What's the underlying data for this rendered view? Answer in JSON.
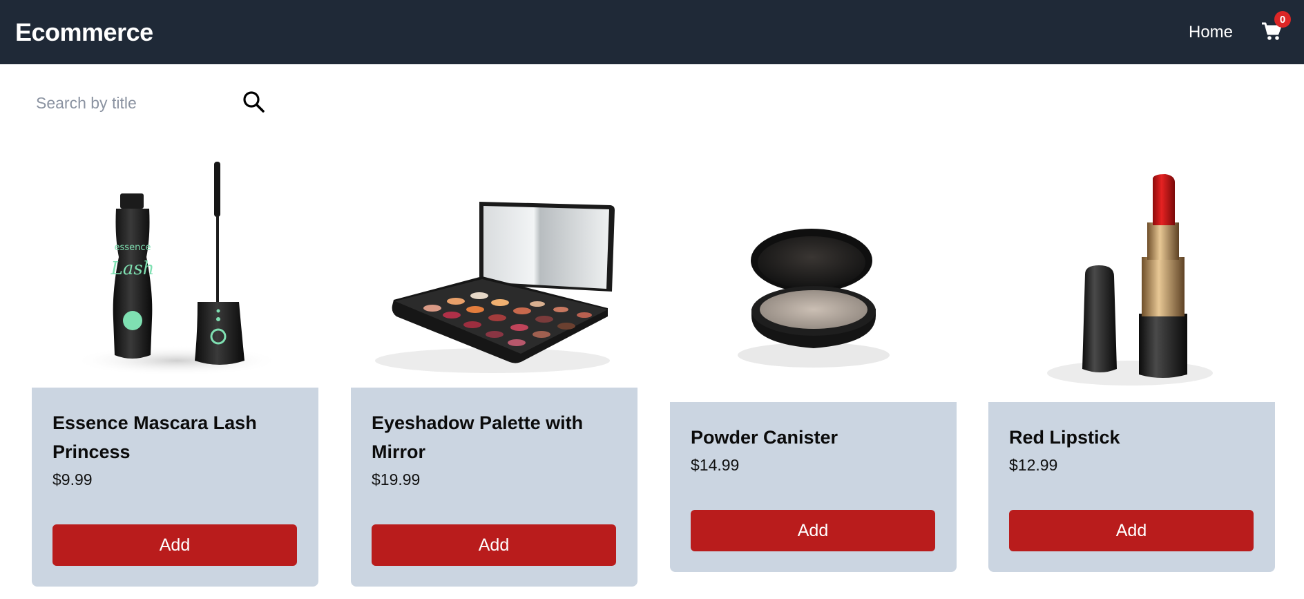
{
  "navbar": {
    "brand": "Ecommerce",
    "home_label": "Home",
    "cart_count": "0"
  },
  "search": {
    "placeholder": "Search by title",
    "value": ""
  },
  "products": [
    {
      "title": "Essence Mascara Lash Princess",
      "price": "$9.99",
      "button_label": "Add",
      "image": "mascara-image"
    },
    {
      "title": "Eyeshadow Palette with Mirror",
      "price": "$19.99",
      "button_label": "Add",
      "image": "eyeshadow-palette-image"
    },
    {
      "title": "Powder Canister",
      "price": "$14.99",
      "button_label": "Add",
      "image": "powder-compact-image"
    },
    {
      "title": "Red Lipstick",
      "price": "$12.99",
      "button_label": "Add",
      "image": "lipstick-image"
    }
  ],
  "colors": {
    "navbar_bg": "#1f2937",
    "card_bg": "#cbd5e1",
    "button_bg": "#b91c1c",
    "badge_bg": "#dc2626"
  }
}
